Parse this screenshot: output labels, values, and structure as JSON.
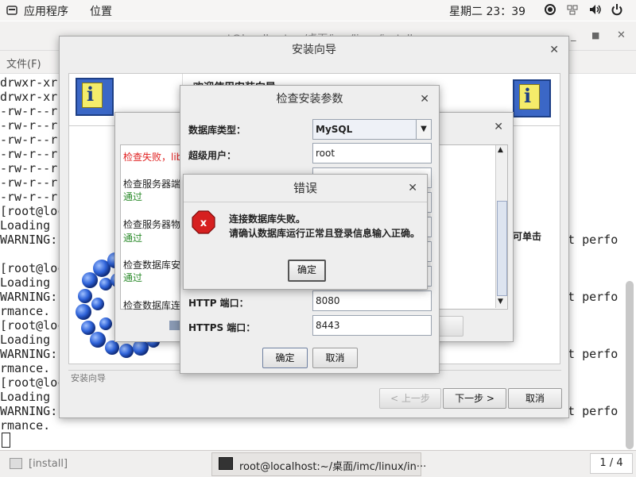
{
  "topbar": {
    "apps": "应用程序",
    "places": "位置",
    "datetime": "星期二 23：39"
  },
  "terminal": {
    "title": "root@localhost: ~/桌面/imc/linux/install",
    "menu_file": "文件(F)",
    "left_lines": [
      "drwxr-xr-",
      "drwxr-xr-",
      "-rw-r--r-",
      "-rw-r--r-",
      "-rw-r--r-",
      "-rw-r--r-",
      "-rw-r--r-",
      "-rw-r--r-",
      "-rw-r--r-",
      "[root@loc",
      "Loading  ",
      "WARNING: ",
      "[root@loc",
      "Loading  ",
      "WARNING: ",
      "rmance.",
      "[root@loc",
      "Loading  ",
      "WARNING: ",
      "rmance.",
      "[root@loc",
      "Loading  ",
      "WARNING: ",
      "rmance."
    ],
    "right_text": "ct perfo"
  },
  "wizard": {
    "title": "安装向导",
    "welcome": "欢迎使用安装向导",
    "right_hint": "可单击",
    "footer_label": "安装向导",
    "back": "< 上一步",
    "next": "下一步 >",
    "cancel": "取消"
  },
  "check_window": {
    "items": [
      {
        "label": "检查失败，lib",
        "status": ""
      },
      {
        "label": "检查服务器端",
        "status": "通过"
      },
      {
        "label": "检查服务器物",
        "status": "通过"
      },
      {
        "label": "检查数据库安",
        "status": "通过"
      },
      {
        "label": "检查数据库连",
        "status": ""
      }
    ],
    "button_partial": "出"
  },
  "params_dialog": {
    "title": "检查安装参数",
    "db_type_label": "数据库类型：",
    "db_type_value": "MySQL",
    "superuser_label": "超级用户：",
    "superuser_value": "root",
    "http_label": "HTTP 端口：",
    "http_value": "8080",
    "https_label": "HTTPS 端口：",
    "https_value": "8443",
    "ok": "确定",
    "cancel": "取消"
  },
  "error_dialog": {
    "title": "错误",
    "line1": "连接数据库失败。",
    "line2": "请确认数据库运行正常且登录信息输入正确。",
    "ok": "确定"
  },
  "taskbar": {
    "item1": "[install]",
    "item2": "root@localhost:~/桌面/imc/linux/in···",
    "workspace": "1 / 4"
  },
  "colors": {
    "error_red": "#d62020",
    "pass_green": "#2a8a2a",
    "fail_red": "#e02020"
  }
}
